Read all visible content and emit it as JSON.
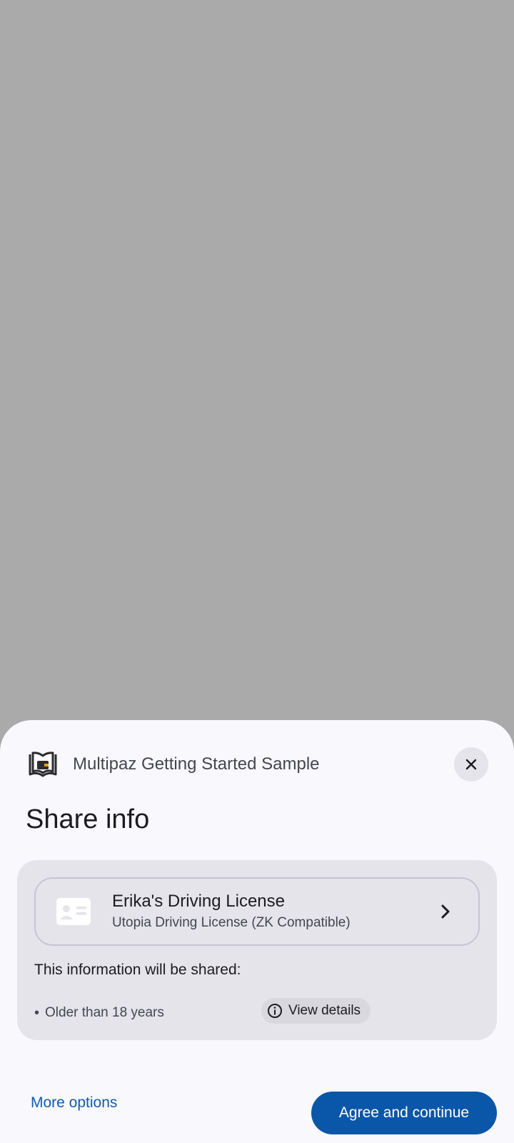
{
  "scrim": {
    "color": "#aaaaaa"
  },
  "sheet": {
    "app_name": "Multipaz Getting Started Sample",
    "app_icon": "wallet-book-icon",
    "close_icon": "close-icon",
    "title": "Share info",
    "document": {
      "title": "Erika's Driving License",
      "subtitle": "Utopia Driving License (ZK Compatible)",
      "icon": "id-card-icon",
      "chevron_icon": "chevron-right-icon"
    },
    "shared_heading": "This information will be shared:",
    "claims": [
      {
        "label": "Older than 18 years"
      }
    ],
    "view_details": {
      "label": "View details",
      "icon": "info-icon"
    },
    "actions": {
      "more_options": "More options",
      "agree": "Agree and continue"
    }
  },
  "colors": {
    "sheet_bg": "#f8f8fd",
    "card_bg": "#e4e4ea",
    "primary": "#0a57a9",
    "link": "#0d5cb0"
  }
}
